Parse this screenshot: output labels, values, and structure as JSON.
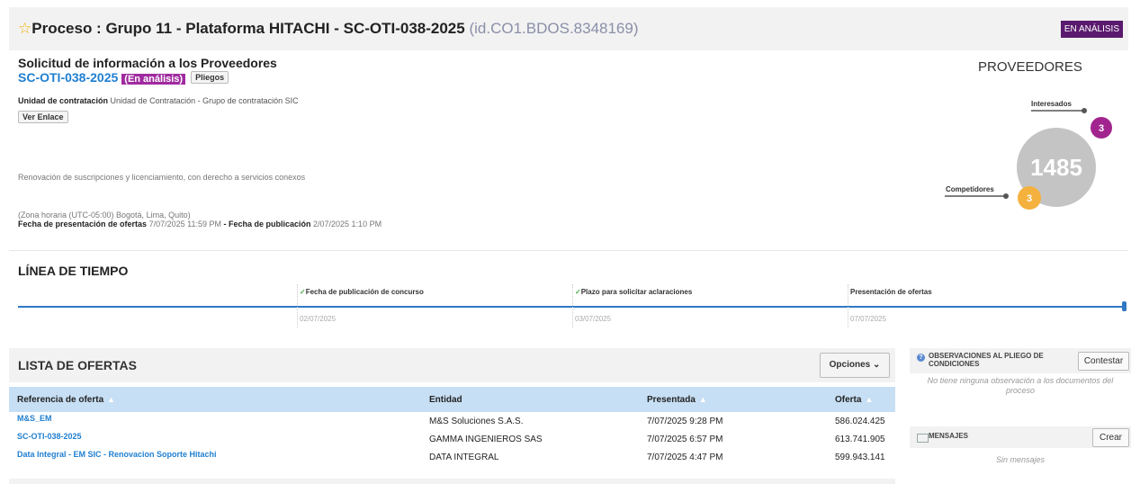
{
  "header": {
    "star": "☆",
    "title": "Proceso : Grupo 11 - Plataforma HITACHI - SC-OTI-038-2025",
    "process_id": "(id.CO1.BDOS.8348169)",
    "status": "EN ANÁLISIS"
  },
  "info": {
    "title": "Solicitud de información a los Proveedores",
    "code": "SC-OTI-038-2025",
    "code_status": "(En análisis)",
    "pliegos_button": "Pliegos",
    "unit_label": "Unidad de contratación",
    "unit_value": "Unidad de Contratación - Grupo de contratación SIC",
    "ver_enlace_button": "Ver Enlace",
    "description": "Renovación de suscripciones y licenciamiento, con derecho a servicios conexos",
    "timezone": "(Zona horaria (UTC-05:00) Bogotá, Lima, Quito)",
    "presentation_label": "Fecha de presentación de ofertas",
    "presentation_value": "7/07/2025 11:59 PM",
    "separator": " - ",
    "publication_label": "Fecha de publicación",
    "publication_value": "2/07/2025 1:10 PM"
  },
  "proveedores": {
    "title": "PROVEEDORES",
    "interesados_label": "Interesados",
    "interesados_count": "3",
    "total": "1485",
    "competidores_label": "Competidores",
    "competidores_count": "3",
    "colors": {
      "interesados": "#a2258f",
      "competidores": "#f5b13d",
      "total": "#c4c4c4"
    }
  },
  "timeline": {
    "title": "LÍNEA DE TIEMPO",
    "events": [
      {
        "label": "Fecha de publicación de concurso",
        "date": "02/07/2025",
        "checked": true
      },
      {
        "label": "Plazo para solicitar aclaraciones",
        "date": "03/07/2025",
        "checked": true
      },
      {
        "label": "Presentación de ofertas",
        "date": "07/07/2025",
        "checked": false
      }
    ]
  },
  "offers": {
    "title": "LISTA DE OFERTAS",
    "options_button": "Opciones",
    "columns": [
      "Referencia de oferta",
      "Entidad",
      "Presentada",
      "Oferta"
    ],
    "rows": [
      {
        "ref": "M&S_EM",
        "entity": "M&S Soluciones S.A.S.",
        "submitted": "7/07/2025 9:28 PM",
        "amount": "586.024.425"
      },
      {
        "ref": "SC-OTI-038-2025",
        "entity": "GAMMA INGENIEROS SAS",
        "submitted": "7/07/2025 6:57 PM",
        "amount": "613.741.905"
      },
      {
        "ref": "Data Integral - EM SIC - Renovacion Soporte Hitachi",
        "entity": "DATA INTEGRAL",
        "submitted": "7/07/2025 4:47 PM",
        "amount": "599.943.141"
      }
    ]
  },
  "observations": {
    "title_line1": "OBSERVACIONES AL PLIEGO DE",
    "title_line2": "CONDICIONES",
    "button": "Contestar",
    "empty_line1": "No tiene ninguna observación a los documentos del",
    "empty_line2": "proceso"
  },
  "messages": {
    "title": "MENSAJES",
    "button": "Crear",
    "empty": "Sin mensajes"
  }
}
